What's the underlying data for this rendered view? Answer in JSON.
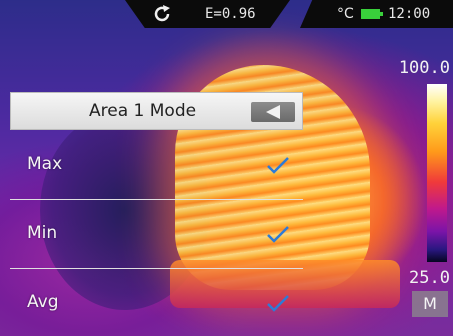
{
  "status": {
    "emissivity": "E=0.96",
    "unit": "°C",
    "time": "12:00",
    "battery_color": "#39d03b"
  },
  "scale": {
    "max": "100.0",
    "min": "25.0",
    "mode": "M"
  },
  "menu": {
    "title": "Area 1 Mode",
    "items": [
      {
        "label": "Max",
        "checked": true
      },
      {
        "label": "Min",
        "checked": true
      },
      {
        "label": "Avg",
        "checked": true
      }
    ],
    "check_color": "#2e7bd6"
  },
  "icons": {
    "refresh": "refresh-icon",
    "back": "back-arrow-icon",
    "battery": "battery-icon",
    "check": "checkmark-icon"
  }
}
